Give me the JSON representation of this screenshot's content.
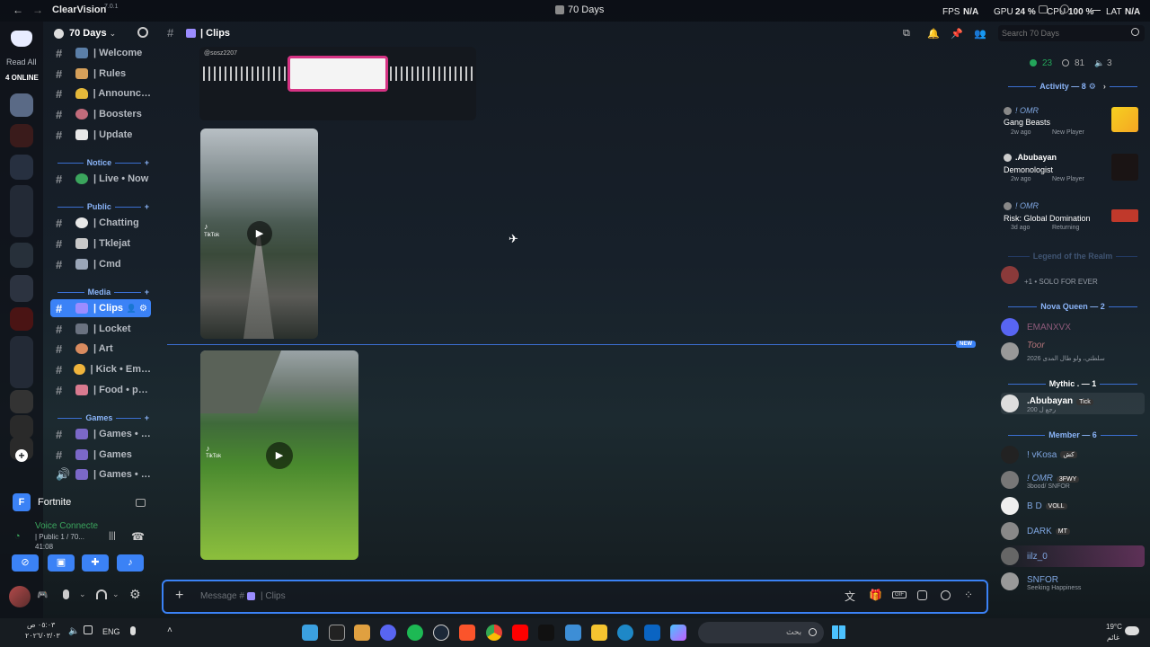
{
  "app": {
    "name": "ClearVision",
    "version": "7.0.1",
    "window_title": "70 Days"
  },
  "stats": {
    "fps_label": "FPS",
    "fps": "N/A",
    "gpu_label": "GPU",
    "gpu": "24 %",
    "cpu_label": "CPU",
    "cpu": "100 %",
    "lat_label": "LAT",
    "lat": "N/A"
  },
  "rail": {
    "read_all": "Read All",
    "online": "4 ONLINE"
  },
  "server": {
    "name": "70 Days"
  },
  "categories": {
    "notice": "Notice",
    "public": "Public",
    "media": "Media",
    "games": "Games"
  },
  "channels": [
    {
      "label": "| Welcome"
    },
    {
      "label": "| Rules"
    },
    {
      "label": "| Announc…"
    },
    {
      "label": "| Boosters"
    },
    {
      "label": "| Update"
    },
    {
      "label": "| Live • Now"
    },
    {
      "label": "| Chatting"
    },
    {
      "label": "| Tklejat"
    },
    {
      "label": "| Cmd"
    },
    {
      "label": "| Clips"
    },
    {
      "label": "| Locket"
    },
    {
      "label": "| Art"
    },
    {
      "label": "| Kick • Em…"
    },
    {
      "label": "| Food • p…"
    },
    {
      "label": "| Games • …"
    },
    {
      "label": "| Games"
    },
    {
      "label": "| Games • …"
    }
  ],
  "activity_game": "Fortnite",
  "voice": {
    "status": "Voice Connecte",
    "channel": "| Public 1 / 70...",
    "time": "41:08"
  },
  "header": {
    "channel": "| Clips",
    "search_placeholder": "Search 70 Days"
  },
  "messages": {
    "uploader_tag": "@sosz2207",
    "tiktok_label": "TikTok",
    "new_badge": "NEW"
  },
  "composer": {
    "prefix": "Message #",
    "channel": "| Clips"
  },
  "counts": {
    "online": "23",
    "offline": "81",
    "voice": "3"
  },
  "activity": {
    "title": "Activity — 8",
    "items": [
      {
        "user": "! OMR",
        "game": "Gang Beasts",
        "time": "2w ago",
        "status": "New Player"
      },
      {
        "user": ".Abubayan",
        "game": "Demonologist",
        "time": "2w ago",
        "status": "New Player"
      },
      {
        "user": "! OMR",
        "game": "Risk: Global Domination",
        "time": "3d ago",
        "status": "Returning"
      }
    ]
  },
  "roles": {
    "legend": "Legend of the Realm",
    "nova": "Nova Queen — 2",
    "mythic": "Mythic . — 1",
    "member": "Member — 6"
  },
  "members": {
    "legend_sub": "+1 • SOLO FOR EVER",
    "nova1": "EMANXVX",
    "nova2": "Toor",
    "nova2_sub": "سلطتي، ولو طال المدى 2026",
    "mythic1": ".Abubayan",
    "mythic1_tag": "Tick",
    "mythic1_sub": "رجع ل 200",
    "m1": "! vKosa",
    "m1_tag": "كش",
    "m2": "! OMR",
    "m2_tag": "3FWY",
    "m2_sub": "3bood/ SNFOR",
    "m3": "B D",
    "m3_tag": "VOLL",
    "m4": "DARK",
    "m4_tag": "MT",
    "m5": "iilz_0",
    "m6": "SNFOR",
    "m6_sub": "Seeking Happiness"
  },
  "taskbar": {
    "time": "٠٥:٠٣ ص",
    "date": "٢٠٢٦/٠٣/٠٣",
    "lang": "ENG",
    "search": "بحث",
    "temp": "19°C",
    "weather": "غائم"
  },
  "colors": {
    "accent": "#3b82f6",
    "online": "#23a55a"
  }
}
